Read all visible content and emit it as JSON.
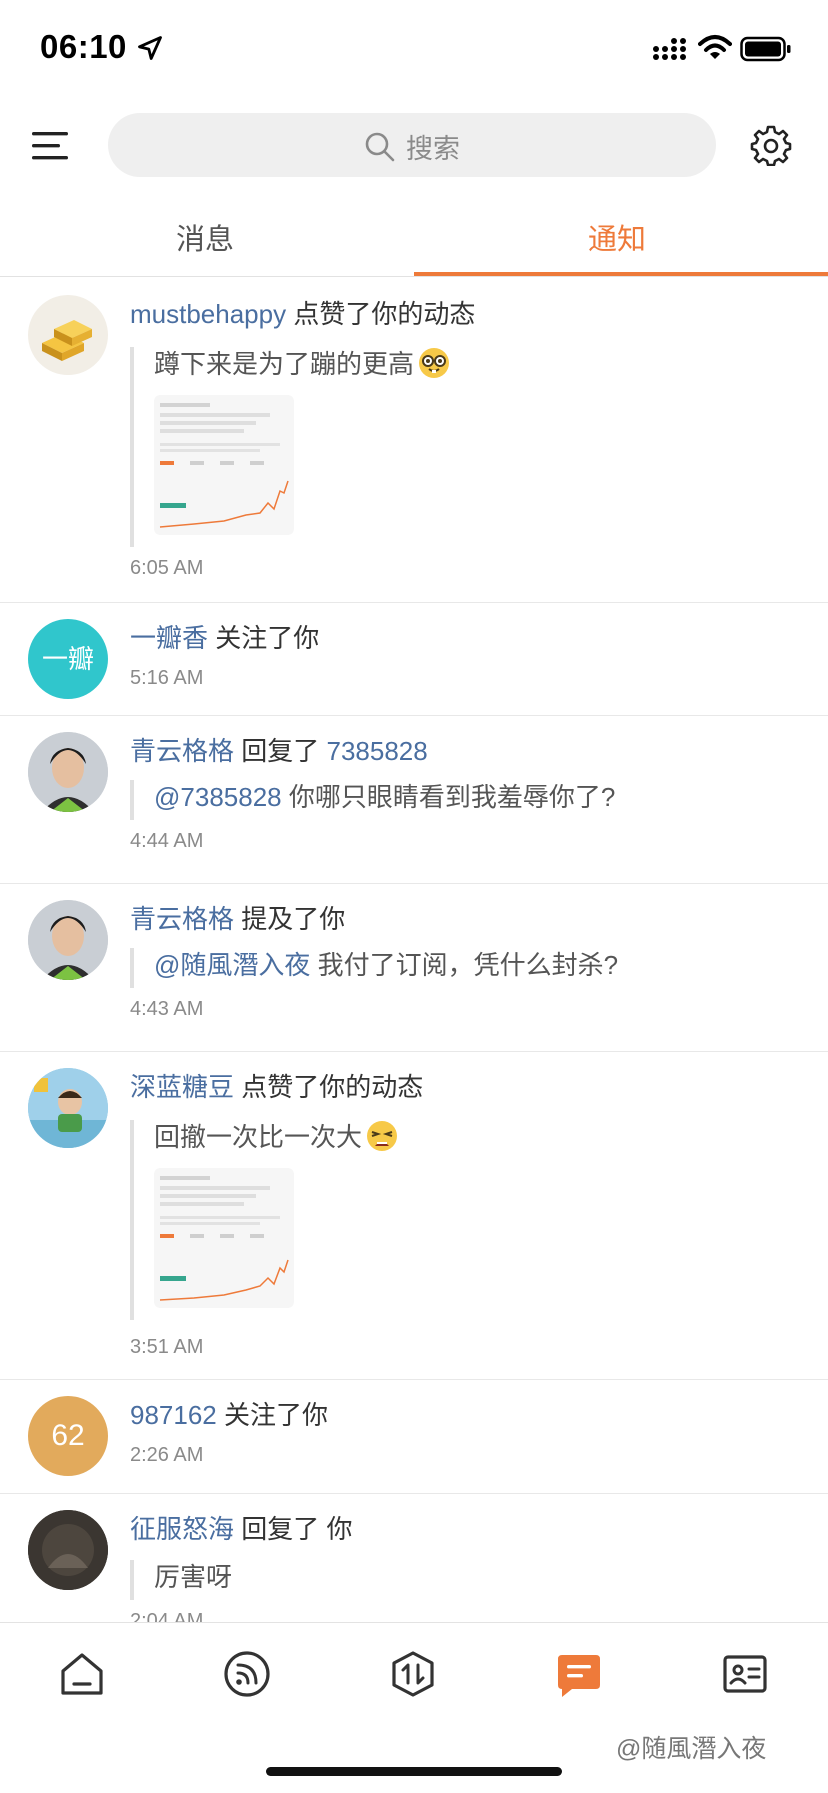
{
  "status_bar": {
    "time": "06:10"
  },
  "search": {
    "placeholder": "搜索"
  },
  "tabs": [
    {
      "label": "消息",
      "active": false
    },
    {
      "label": "通知",
      "active": true
    }
  ],
  "notifications": [
    {
      "user": "mustbehappy",
      "action": "点赞了你的动态",
      "quote": "蹲下来是为了蹦的更高",
      "emoji": "nerd-face-emoji",
      "image": true,
      "time": "6:05 AM"
    },
    {
      "user": "一瓣香",
      "action": "关注了你",
      "avatar_text": "一瓣",
      "time": "5:16 AM"
    },
    {
      "user": "青云格格",
      "action": "回复了",
      "target": "7385828",
      "quote_mention": "@7385828",
      "quote": "你哪只眼睛看到我羞辱你了?",
      "time": "4:44 AM"
    },
    {
      "user": "青云格格",
      "action": "提及了你",
      "quote_mention": "@随風潛入夜",
      "quote": "我付了订阅，凭什么封杀?",
      "time": "4:43 AM"
    },
    {
      "user": "深蓝糖豆",
      "action": "点赞了你的动态",
      "quote": "回撤一次比一次大",
      "emoji": "tired-face-emoji",
      "image": true,
      "time": "3:51 AM"
    },
    {
      "user": "987162",
      "action": "关注了你",
      "avatar_text": "62",
      "time": "2:26 AM"
    },
    {
      "user": "征服怒海",
      "action": "回复了",
      "target": "你",
      "quote": "厉害呀",
      "time": "2:04 AM"
    }
  ],
  "bottom_nav": [
    {
      "icon": "home-icon",
      "active": false
    },
    {
      "icon": "feed-icon",
      "active": false
    },
    {
      "icon": "trade-icon",
      "active": false
    },
    {
      "icon": "notification-icon",
      "active": true
    },
    {
      "icon": "profile-card-icon",
      "active": false
    }
  ],
  "watermark": "@随風潛入夜",
  "colors": {
    "accent": "#ee7a3a",
    "username": "#4a6ea0",
    "timestamp": "#8a8a8a"
  }
}
